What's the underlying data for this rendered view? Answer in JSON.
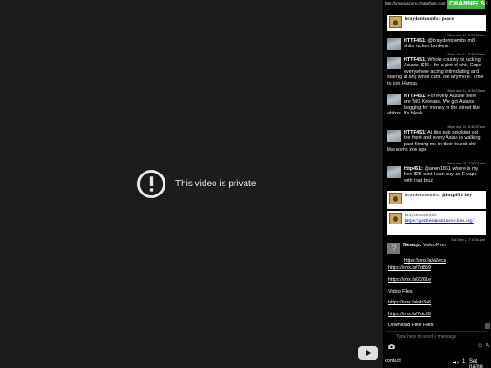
{
  "video": {
    "private_text": "This video is private"
  },
  "sidebar": {
    "url": "http://amerixazone.chaturbate.com",
    "channels_label": "CHANNELS",
    "close": "x",
    "messages": [
      {
        "id": "m0",
        "user": "braydentoombs:",
        "text": "peace"
      },
      {
        "id": "m1",
        "ts": "Mon Nov 13, 5:37:39am",
        "user": "HTTP451:",
        "text": "@braydentoombs m8 shits fucken bonkers."
      },
      {
        "id": "m2",
        "ts": "Mon Nov 13, 5:39:00am",
        "user": "HTTP451:",
        "text": "Whole country is fucking Asians. $16+ for a pint of shit. Cops everywhere acting intimidating and staring at any white cunt. Idk anymore. Time to join Hamas."
      },
      {
        "id": "m3",
        "ts": "Mon Nov 13, 5:39:03am",
        "user": "HTTP451:",
        "text": "For every Aussie there are 500 Koreans. We got Asians begging for money in the street like abbos. It's bleak"
      },
      {
        "id": "m4",
        "ts": "Mon Nov 20, 5:40:37am",
        "user": "HTTP451:",
        "text": "At this pub smoking out the front and every Asian is walking past filming me in their tourist shit like some zoo ape"
      },
      {
        "id": "m5",
        "ts": "Mon Nov 20, 2:50:01am",
        "user": "http451:",
        "text": "@anon1861 where is my free $25 cunt I can buy an E vape with that bruz"
      }
    ],
    "white_msgs": [
      {
        "id": "w1",
        "user": "braydentoombs:",
        "text": "@http451 hey"
      },
      {
        "id": "w2",
        "user": "braydentoombs:",
        "link": "https://gentlestream.neocities.org/"
      }
    ],
    "grey_msg": {
      "ts": "Sat Dec 2, 7:10:51pm",
      "user": "filewup:",
      "text": "Video Prev",
      "link": "https://onx.la/a2eca"
    },
    "links": [
      "https://onx.la/7d859",
      "https://onx.la/2261e"
    ],
    "video_files_label": "Video Files",
    "links2": [
      "https://onx.la/ab3a6",
      "https://onx.la/7dc90"
    ],
    "download_label": "Download Free Files",
    "input_placeholder": "Type here to send a message",
    "emoji": "☺",
    "font_btn": "A",
    "contact": "contact",
    "user_count": "1",
    "set_name": "Set name"
  }
}
